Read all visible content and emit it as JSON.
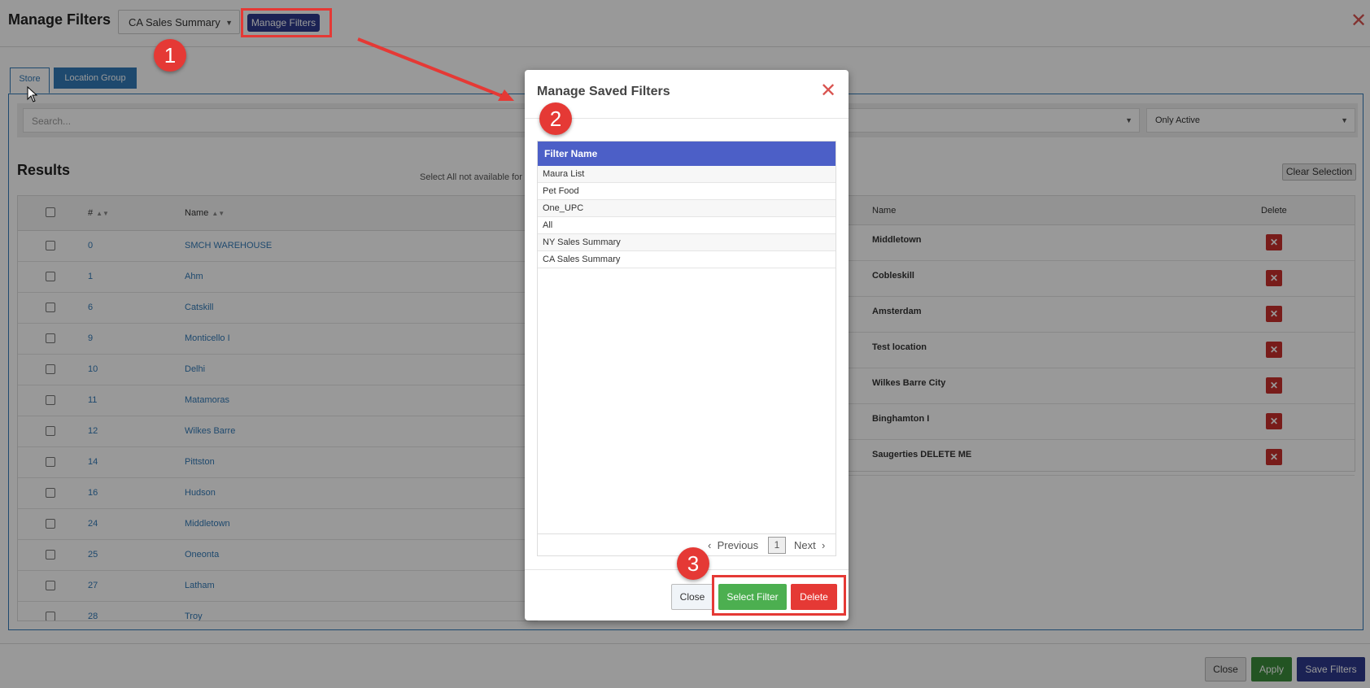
{
  "header": {
    "title": "Manage Filters",
    "filter_select_value": "CA Sales Summary",
    "manage_button": "Manage Filters"
  },
  "tabs": [
    {
      "label": "Store"
    },
    {
      "label": "Location Group"
    }
  ],
  "search": {
    "placeholder": "Search...",
    "status_filter": "Only Active"
  },
  "results": {
    "title": "Results",
    "note": "Select All not available for",
    "clear_button": "Clear Selection",
    "columns": [
      "#",
      "Name"
    ],
    "rows": [
      {
        "num": "0",
        "name": "SMCH WAREHOUSE"
      },
      {
        "num": "1",
        "name": "Ahm"
      },
      {
        "num": "6",
        "name": "Catskill"
      },
      {
        "num": "9",
        "name": "Monticello I"
      },
      {
        "num": "10",
        "name": "Delhi"
      },
      {
        "num": "11",
        "name": "Matamoras"
      },
      {
        "num": "12",
        "name": "Wilkes Barre"
      },
      {
        "num": "14",
        "name": "Pittston"
      },
      {
        "num": "16",
        "name": "Hudson"
      },
      {
        "num": "24",
        "name": "Middletown"
      },
      {
        "num": "25",
        "name": "Oneonta"
      },
      {
        "num": "27",
        "name": "Latham"
      },
      {
        "num": "28",
        "name": "Troy"
      }
    ]
  },
  "selected": {
    "columns": [
      "Name",
      "Delete"
    ],
    "rows": [
      "Middletown",
      "Cobleskill",
      "Amsterdam",
      "Test location",
      "Wilkes Barre City",
      "Binghamton I",
      "Saugerties DELETE ME"
    ]
  },
  "footer": {
    "close": "Close",
    "apply": "Apply",
    "save": "Save Filters"
  },
  "modal": {
    "title": "Manage Saved Filters",
    "column": "Filter Name",
    "filters": [
      "Maura List",
      "Pet Food",
      "One_UPC",
      "All",
      "NY Sales Summary",
      "CA Sales Summary"
    ],
    "pager": {
      "prev": "Previous",
      "page": "1",
      "next": "Next"
    },
    "close": "Close",
    "select": "Select Filter",
    "delete": "Delete"
  },
  "annotations": [
    "1",
    "2",
    "3"
  ],
  "colors": {
    "accent": "#2d3a8c",
    "annotation": "#e53935",
    "table_header": "#4c5fc7",
    "success": "#4caf50"
  }
}
